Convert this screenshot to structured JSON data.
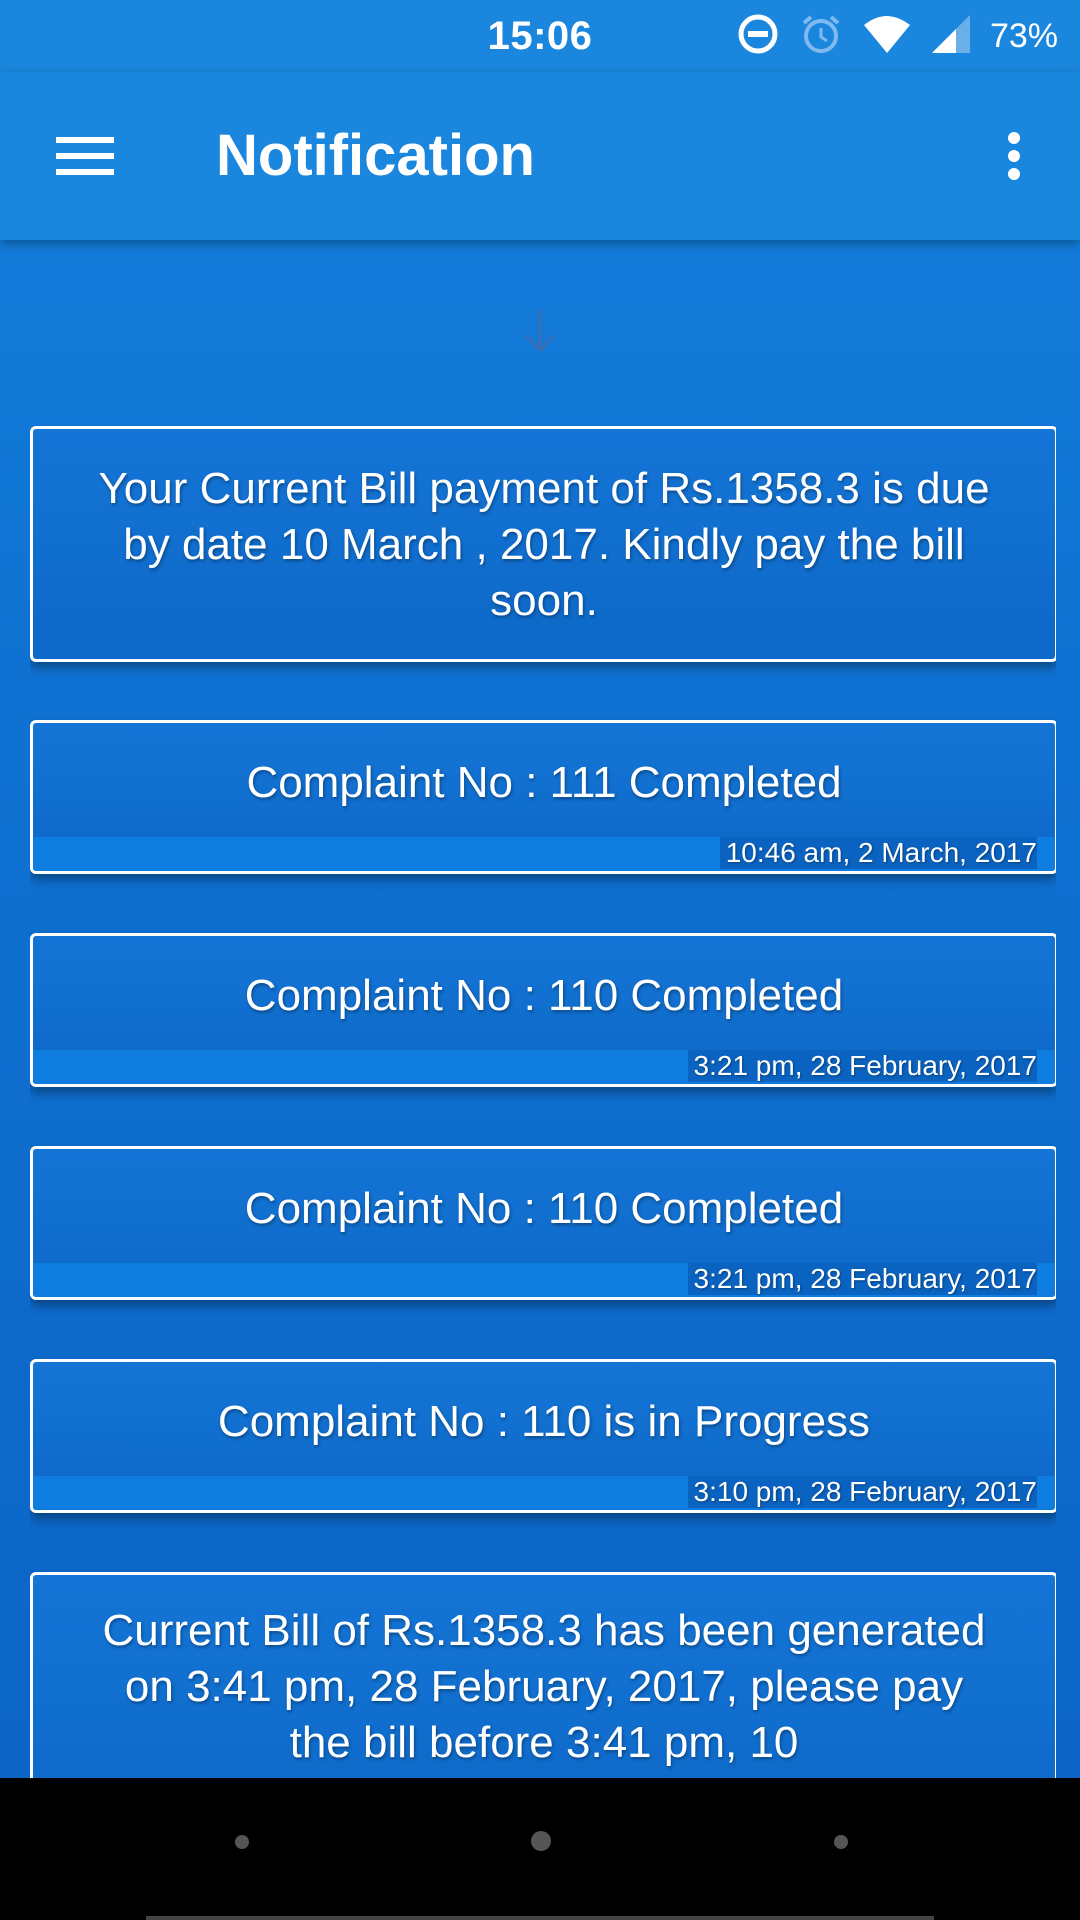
{
  "status_bar": {
    "time": "15:06",
    "battery": "73%",
    "icons": [
      "do-not-disturb-icon",
      "alarm-icon",
      "wifi-icon",
      "cell-signal-icon"
    ]
  },
  "app_bar": {
    "title": "Notification",
    "menu_icon": "hamburger-menu-icon",
    "overflow_icon": "more-vert-icon"
  },
  "refresh_indicator": {
    "icon": "arrow-down-icon"
  },
  "notifications": [
    {
      "message": "Your Current Bill payment of Rs.1358.3 is due by date 10 March , 2017. Kindly pay the bill soon.",
      "timestamp": ""
    },
    {
      "message": "Complaint No : 111 Completed",
      "timestamp": "10:46 am, 2 March, 2017"
    },
    {
      "message": "Complaint No : 110 Completed",
      "timestamp": "3:21 pm, 28 February, 2017"
    },
    {
      "message": "Complaint No : 110 Completed",
      "timestamp": "3:21 pm, 28 February, 2017"
    },
    {
      "message": "Complaint No : 110 is in Progress",
      "timestamp": "3:10 pm, 28 February, 2017"
    },
    {
      "message": "Current Bill of Rs.1358.3 has been generated on 3:41 pm, 28 February, 2017, please pay the bill before 3:41 pm, 10",
      "timestamp": ""
    }
  ],
  "nav_bar": {
    "buttons": [
      "nav-back-icon",
      "nav-home-icon",
      "nav-recents-icon"
    ]
  },
  "colors": {
    "primary": "#1a86dd",
    "background": "#0d6fce",
    "card_border": "#ffffff",
    "footer_strip": "#0e7ddf"
  }
}
